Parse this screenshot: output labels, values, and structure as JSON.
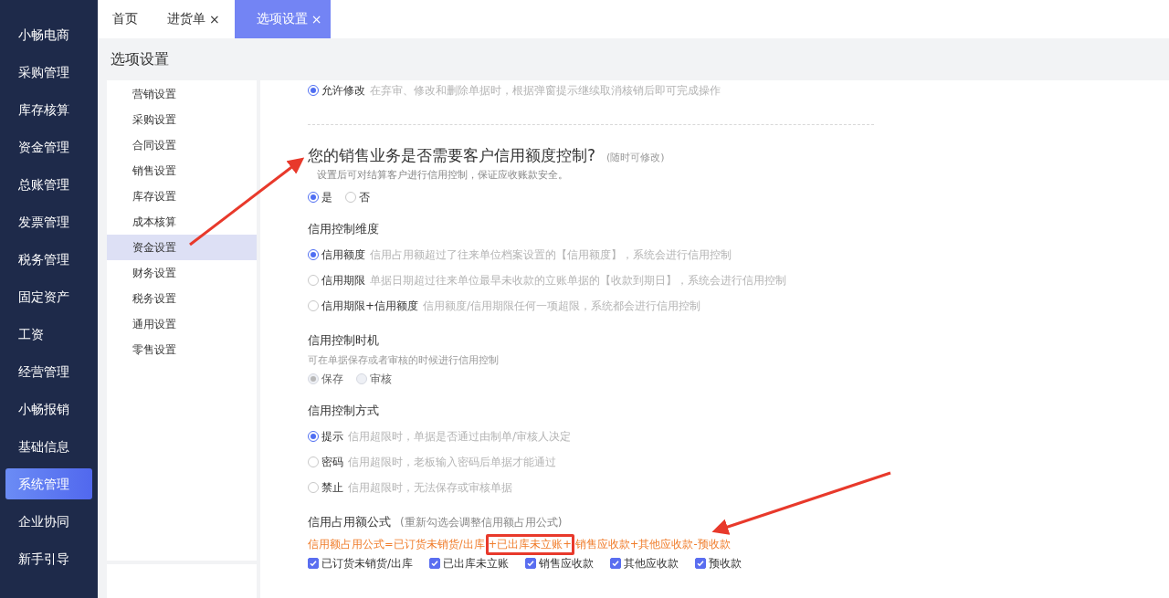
{
  "sidebar": {
    "items": [
      {
        "label": "小畅电商",
        "selected": false
      },
      {
        "label": "采购管理",
        "selected": false
      },
      {
        "label": "库存核算",
        "selected": false
      },
      {
        "label": "资金管理",
        "selected": false
      },
      {
        "label": "总账管理",
        "selected": false
      },
      {
        "label": "发票管理",
        "selected": false
      },
      {
        "label": "税务管理",
        "selected": false
      },
      {
        "label": "固定资产",
        "selected": false
      },
      {
        "label": "工资",
        "selected": false
      },
      {
        "label": "经营管理",
        "selected": false
      },
      {
        "label": "小畅报销",
        "selected": false
      },
      {
        "label": "基础信息",
        "selected": false
      },
      {
        "label": "系统管理",
        "selected": true
      },
      {
        "label": "企业协同",
        "selected": false
      },
      {
        "label": "新手引导",
        "selected": false
      }
    ]
  },
  "tabs": [
    {
      "label": "首页",
      "selected": false
    },
    {
      "label": "进货单",
      "close": "×",
      "selected": false
    },
    {
      "label": "选项设置",
      "close": "×",
      "selected": true
    }
  ],
  "page_title": "选项设置",
  "settings_menu": {
    "items": [
      {
        "label": "营销设置",
        "selected": false
      },
      {
        "label": "采购设置",
        "selected": false
      },
      {
        "label": "合同设置",
        "selected": false
      },
      {
        "label": "销售设置",
        "selected": false
      },
      {
        "label": "库存设置",
        "selected": false
      },
      {
        "label": "成本核算",
        "selected": false
      },
      {
        "label": "资金设置",
        "selected": true
      },
      {
        "label": "财务设置",
        "selected": false
      },
      {
        "label": "税务设置",
        "selected": false
      },
      {
        "label": "通用设置",
        "selected": false
      },
      {
        "label": "零售设置",
        "selected": false
      }
    ]
  },
  "edit_option": {
    "label": "允许修改",
    "hint": "在弃审、修改和删除单据时，根据弹窗提示继续取消核销后即可完成操作",
    "selected": true
  },
  "credit_question": {
    "title": "您的销售业务是否需要客户信用额度控制?",
    "note": "(随时可修改)",
    "description": "设置后可对结算客户进行信用控制，保证应收账款安全。",
    "options": [
      {
        "label": "是",
        "selected": true
      },
      {
        "label": "否",
        "selected": false
      }
    ]
  },
  "groups": [
    {
      "kind": "radio",
      "title": "信用控制维度",
      "options": [
        {
          "label": "信用额度",
          "hint": "信用占用额超过了往来单位档案设置的【信用额度】，系统会进行信用控制",
          "selected": true
        },
        {
          "label": "信用期限",
          "hint": "单据日期超过往来单位最早未收款的立账单据的【收款到期日】，系统会进行信用控制",
          "selected": false
        },
        {
          "label": "信用期限+信用额度",
          "hint": "信用额度/信用期限任何一项超限，系统都会进行信用控制",
          "selected": false
        }
      ]
    },
    {
      "kind": "inline-radio",
      "title": "信用控制时机",
      "description": "可在单据保存或者审核的时候进行信用控制",
      "disabled": true,
      "options": [
        {
          "label": "保存",
          "selected": true
        },
        {
          "label": "审核",
          "selected": false
        }
      ]
    },
    {
      "kind": "radio",
      "title": "信用控制方式",
      "options": [
        {
          "label": "提示",
          "hint": "信用超限时，单据是否通过由制单/审核人决定",
          "selected": true
        },
        {
          "label": "密码",
          "hint": "信用超限时，老板输入密码后单据才能通过",
          "selected": false
        },
        {
          "label": "禁止",
          "hint": "信用超限时，无法保存或审核单据",
          "selected": false
        }
      ]
    },
    {
      "kind": "checkbox",
      "title": "信用占用额公式",
      "note": "(重新勾选会调整信用额占用公式)",
      "formula_parts": [
        {
          "text": "信用额占用公式=已订货未销货/出库",
          "highlighted": false
        },
        {
          "text": "+已出库未立账+",
          "highlighted": true
        },
        {
          "text": "销售应收款+其他应收款-预收款",
          "highlighted": false
        }
      ],
      "options": [
        {
          "label": "已订货未销货/出库",
          "checked": true
        },
        {
          "label": "已出库未立账",
          "checked": true
        },
        {
          "label": "销售应收款",
          "checked": true
        },
        {
          "label": "其他应收款",
          "checked": true
        },
        {
          "label": "预收款",
          "checked": true
        }
      ]
    }
  ]
}
